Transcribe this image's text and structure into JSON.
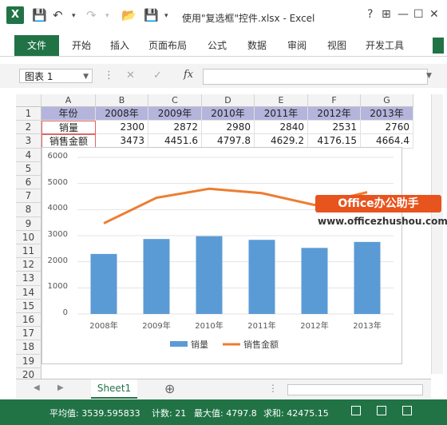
{
  "window": {
    "title": "使用\"复选框\"控件.xlsx - Excel",
    "buttons": [
      "?",
      "⊞",
      "—",
      "☐",
      "✕"
    ]
  },
  "ribbon": {
    "file_tab": "文件",
    "tabs": [
      "开始",
      "插入",
      "页面布局",
      "公式",
      "数据",
      "审阅",
      "视图",
      "开发工具"
    ]
  },
  "formula_bar": {
    "name_box": "图表 1",
    "fx": "fx",
    "value": ""
  },
  "sheet": {
    "columns": [
      "A",
      "B",
      "C",
      "D",
      "E",
      "F",
      "G"
    ],
    "rows": [
      "1",
      "2",
      "3",
      "4",
      "5",
      "6",
      "7",
      "8",
      "9",
      "10",
      "11",
      "12",
      "13",
      "14",
      "15",
      "16",
      "17",
      "18",
      "19",
      "20"
    ],
    "data": [
      [
        "年份",
        "2008年",
        "2009年",
        "2010年",
        "2011年",
        "2012年",
        "2013年"
      ],
      [
        "销量",
        "2300",
        "2872",
        "2980",
        "2840",
        "2531",
        "2760"
      ],
      [
        "销售金额",
        "3473",
        "4451.6",
        "4797.8",
        "4629.2",
        "4176.15",
        "4664.4"
      ]
    ]
  },
  "chart_data": {
    "type": "bar",
    "categories": [
      "2008年",
      "2009年",
      "2010年",
      "2011年",
      "2012年",
      "2013年"
    ],
    "series": [
      {
        "name": "销量",
        "kind": "bar",
        "color": "#5b9bd5",
        "values": [
          2300,
          2872,
          2980,
          2840,
          2531,
          2760
        ]
      },
      {
        "name": "销售金额",
        "kind": "line",
        "color": "#ed7d31",
        "values": [
          3473,
          4451.6,
          4797.8,
          4629.2,
          4176.15,
          4664.4
        ]
      }
    ],
    "yticks": [
      "0",
      "1000",
      "2000",
      "3000",
      "4000",
      "5000",
      "6000"
    ],
    "ylim": [
      0,
      6000
    ],
    "grid": true,
    "legend": "bottom"
  },
  "watermark": {
    "badge": "Office办公助手",
    "url": "www.officezhushou.com"
  },
  "sheet_tabs": {
    "active": "Sheet1",
    "add": "⊕"
  },
  "status": {
    "average": "平均值: 3539.595833",
    "count": "计数: 21",
    "max": "最大值: 4797.8",
    "sum": "求和: 42475.15"
  },
  "colors": {
    "accent": "#217346",
    "header_fill": "#b4b4dd"
  }
}
